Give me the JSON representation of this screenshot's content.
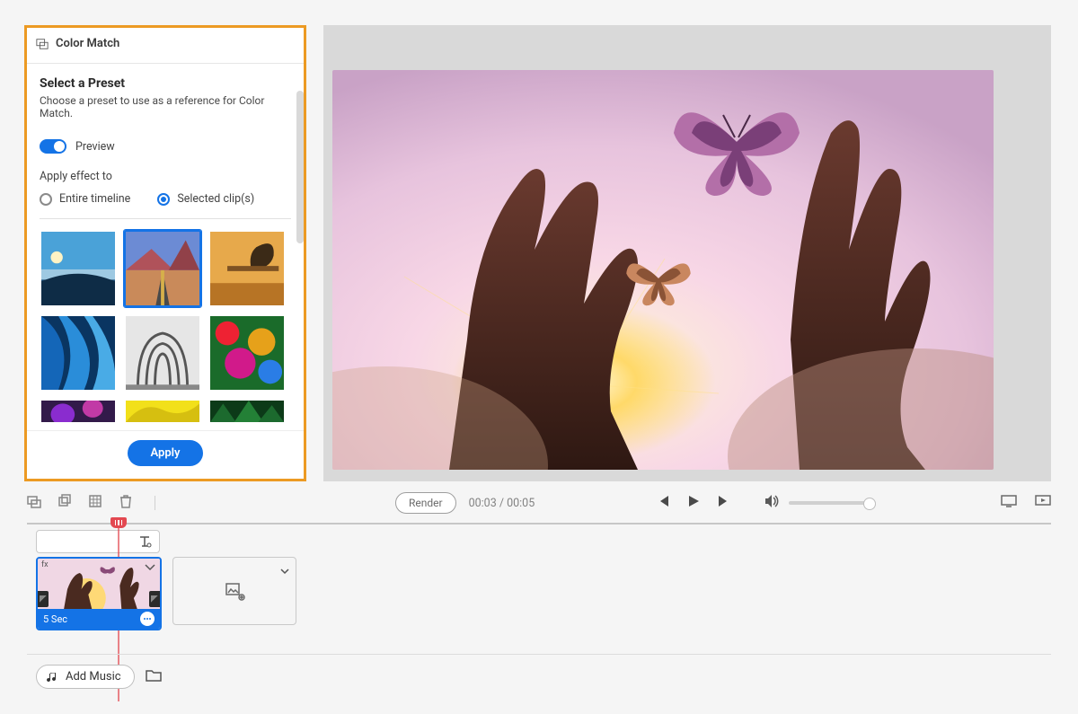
{
  "panel": {
    "title": "Color Match",
    "preset_heading": "Select a Preset",
    "preset_desc": "Choose a preset to use as a reference for Color Match.",
    "preview_label": "Preview",
    "apply_to_label": "Apply effect to",
    "radio_timeline": "Entire timeline",
    "radio_selected": "Selected clip(s)",
    "apply_btn": "Apply",
    "preview_on": true,
    "selected_radio": "selected",
    "selected_preset_index": 1
  },
  "controls": {
    "render_label": "Render",
    "time_current": "00:03",
    "time_total": "00:05"
  },
  "timeline": {
    "clip_duration_label": "5 Sec"
  },
  "music": {
    "add_label": "Add Music"
  }
}
